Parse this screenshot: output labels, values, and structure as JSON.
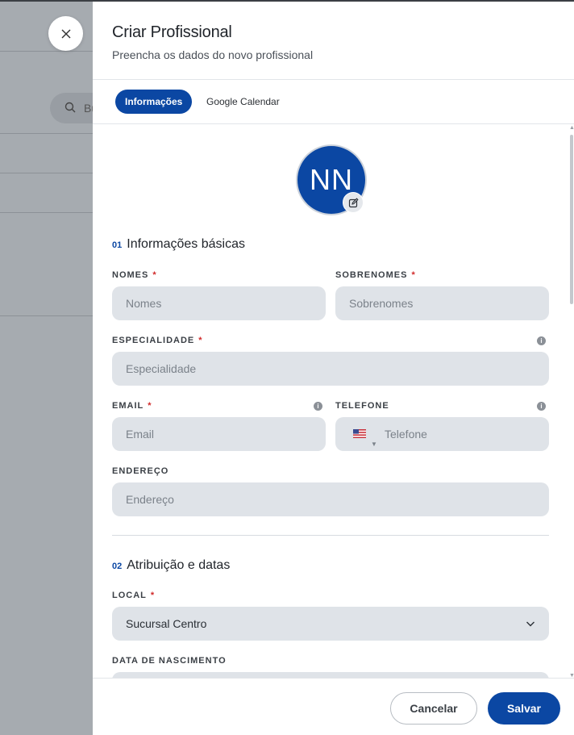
{
  "background": {
    "search_partial_text": "Bu"
  },
  "drawer": {
    "title": "Criar Profissional",
    "subtitle": "Preencha os dados do novo profissional"
  },
  "tabs": [
    {
      "label": "Informações",
      "active": true
    },
    {
      "label": "Google Calendar",
      "active": false
    }
  ],
  "avatar": {
    "initials": "NN"
  },
  "section1": {
    "number": "01",
    "title": "Informações básicas"
  },
  "fields": {
    "nomes": {
      "label": "NOMES",
      "required": "*",
      "placeholder": "Nomes"
    },
    "sobrenomes": {
      "label": "SOBRENOMES",
      "required": "*",
      "placeholder": "Sobrenomes"
    },
    "especialidade": {
      "label": "ESPECIALIDADE",
      "required": "*",
      "placeholder": "Especialidade"
    },
    "email": {
      "label": "EMAIL",
      "required": "*",
      "placeholder": "Email"
    },
    "telefone": {
      "label": "TELEFONE",
      "placeholder": "Telefone"
    },
    "endereco": {
      "label": "ENDEREÇO",
      "placeholder": "Endereço"
    },
    "local": {
      "label": "LOCAL",
      "required": "*",
      "value": "Sucursal Centro"
    },
    "data_nascimento": {
      "label": "DATA DE NASCIMENTO"
    }
  },
  "section2": {
    "number": "02",
    "title": "Atribuição e datas"
  },
  "footer": {
    "cancel_label": "Cancelar",
    "save_label": "Salvar"
  },
  "colors": {
    "accent": "#0b47a3",
    "required": "#d12a2a",
    "field_bg": "#dfe3e8"
  }
}
